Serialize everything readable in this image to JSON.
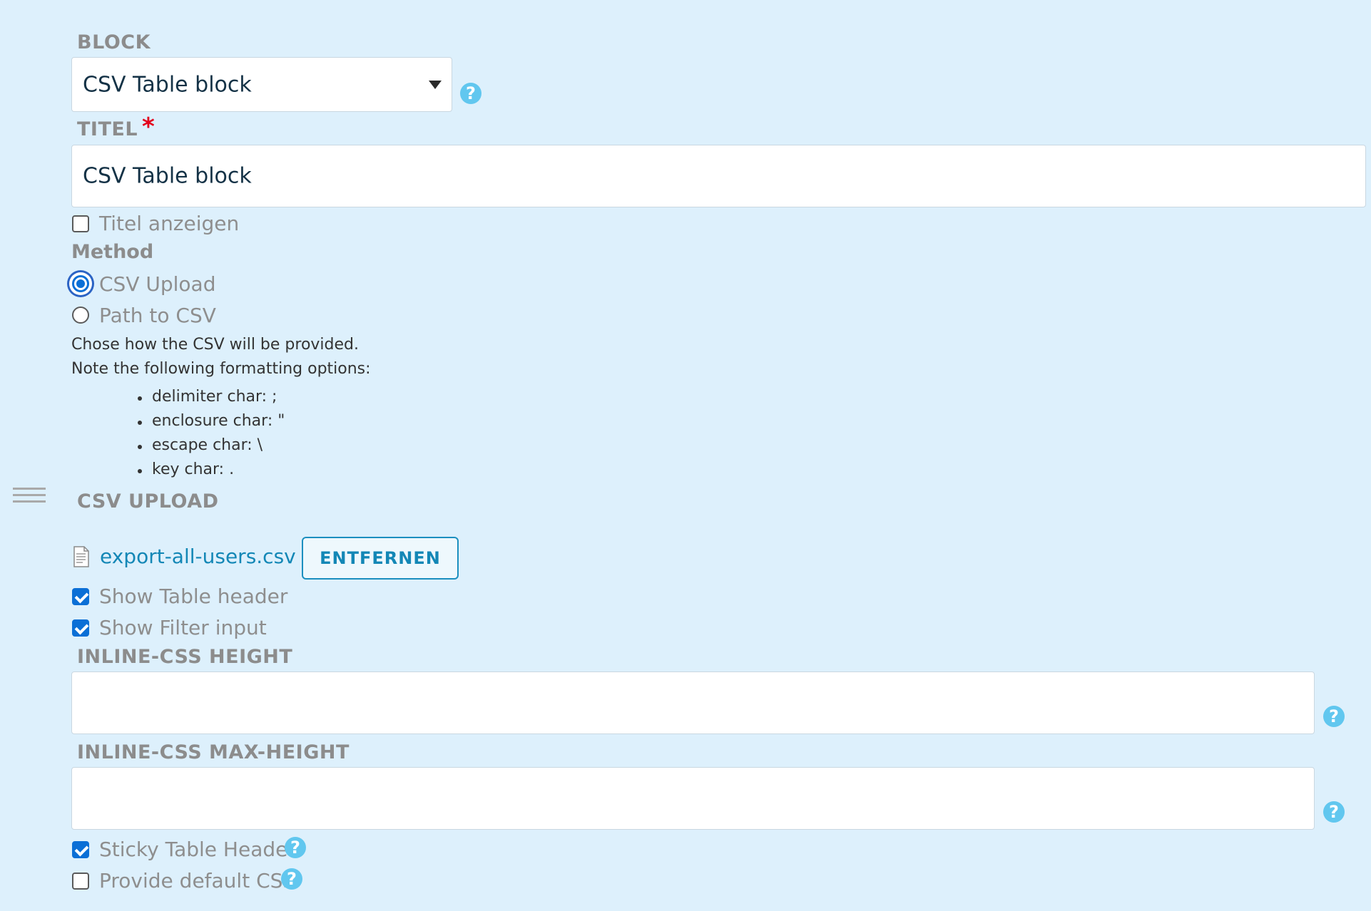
{
  "block": {
    "label": "BLOCK",
    "selected": "CSV Table block",
    "help": "?"
  },
  "titel": {
    "label": "TITEL",
    "required_mark": "*",
    "value": "CSV Table block"
  },
  "show_title": {
    "label": "Titel anzeigen",
    "checked": false
  },
  "method": {
    "label": "Method",
    "options": [
      {
        "label": "CSV Upload",
        "selected": true
      },
      {
        "label": "Path to CSV",
        "selected": false
      }
    ],
    "description_lines": [
      "Chose how the CSV will be provided.",
      "Note the following formatting options:"
    ],
    "format_options": [
      "delimiter char: ;",
      "enclosure char: \"",
      "escape char: \\",
      "key char: ."
    ]
  },
  "csv_upload": {
    "label": "CSV UPLOAD",
    "file_name": "export-all-users.csv",
    "remove_label": "ENTFERNEN"
  },
  "show_table_header": {
    "label": "Show Table header",
    "checked": true
  },
  "show_filter_input": {
    "label": "Show Filter input",
    "checked": true
  },
  "inline_height": {
    "label": "INLINE-CSS HEIGHT",
    "value": "",
    "help": "?"
  },
  "inline_max_height": {
    "label": "INLINE-CSS MAX-HEIGHT",
    "value": "",
    "help": "?"
  },
  "sticky_header": {
    "label": "Sticky Table Header",
    "checked": true,
    "help": "?"
  },
  "default_css": {
    "label": "Provide default CSS",
    "checked": false,
    "help": "?"
  },
  "colors": {
    "background": "#ddf0fc",
    "accent": "#0b6fd6",
    "help": "#61c7ef",
    "link": "#1387b6",
    "required": "#e3001b"
  }
}
